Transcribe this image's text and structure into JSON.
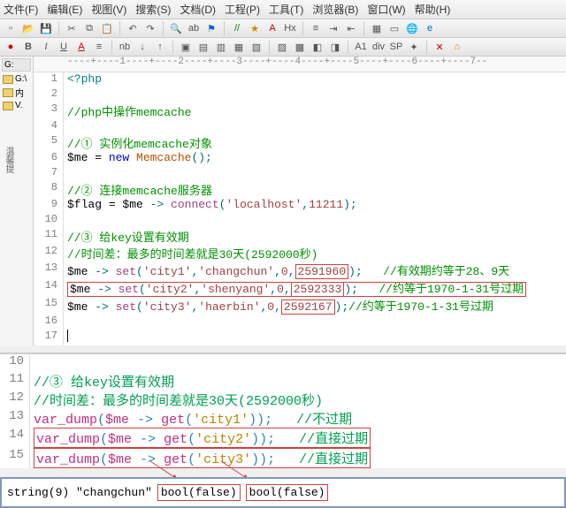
{
  "menu": {
    "file": "文件(F)",
    "edit": "编辑(E)",
    "view": "视图(V)",
    "search": "搜索(S)",
    "doc": "文档(D)",
    "project": "工程(P)",
    "tools": "工具(T)",
    "browser": "浏览器(B)",
    "window": "窗口(W)",
    "help": "帮助(H)"
  },
  "sidebar": {
    "label": "G:",
    "folder1": "G:\\",
    "folder2": "内",
    "folder3": "V.",
    "vertical": "温馨提"
  },
  "ruler": "----+----1----+----2----+----3----+----4----+----5----+----6----+----7--",
  "code1": {
    "l1": "<?php",
    "l3": "//php中操作memcache",
    "l5": "//① 实例化memcache对象",
    "l6_var": "$me",
    "l6_eq": " = ",
    "l6_new": "new",
    "l6_cls": " Memcache",
    "l6_paren": "();",
    "l8": "//② 连接memcache服务器",
    "l9_var": "$flag",
    "l9_eq": " = ",
    "l9_me": "$me",
    "l9_arr": " -> ",
    "l9_fn": "connect",
    "l9_paren": "(",
    "l9_s1": "'localhost'",
    "l9_c": ",",
    "l9_n": "11211",
    "l9_end": ");",
    "l11": "//③ 给key设置有效期",
    "l12": "//时间差：最多的时间差就是30天(2592000秒)",
    "l13_me": "$me",
    "l13_arr": " -> ",
    "l13_fn": "set",
    "l13_p": "(",
    "l13_s1": "'city1'",
    "l13_c1": ",",
    "l13_s2": "'changchun'",
    "l13_c2": ",",
    "l13_n1": "0",
    "l13_c3": ",",
    "l13_n2": "2591960",
    "l13_end": ");",
    "l13_comm": "   //有效期约等于28、9天",
    "l14_me": "$me",
    "l14_arr": " -> ",
    "l14_fn": "set",
    "l14_p": "(",
    "l14_s1": "'city2'",
    "l14_c1": ",",
    "l14_s2": "'shenyang'",
    "l14_c2": ",",
    "l14_n1": "0",
    "l14_c3": ",",
    "l14_n2": "2592333",
    "l14_end": ");",
    "l14_comm": "   //约等于1970-1-31号过期",
    "l15_me": "$me",
    "l15_arr": " -> ",
    "l15_fn": "set",
    "l15_p": "(",
    "l15_s1": "'city3'",
    "l15_c1": ",",
    "l15_s2": "'haerbin'",
    "l15_c2": ",",
    "l15_n1": "0",
    "l15_c3": ",",
    "l15_n2": "2592167",
    "l15_end": ");",
    "l15_comm": "//约等于1970-1-31号过期"
  },
  "code2": {
    "l11": "//③ 给key设置有效期",
    "l12": "//时间差：最多的时间差就是30天(2592000秒)",
    "l13_fn": "var_dump",
    "l13_p": "(",
    "l13_me": "$me",
    "l13_arr": " -> ",
    "l13_get": "get",
    "l13_p2": "(",
    "l13_s": "'city1'",
    "l13_end": "));",
    "l13_comm": "   //不过期",
    "l14_fn": "var_dump",
    "l14_p": "(",
    "l14_me": "$me",
    "l14_arr": " -> ",
    "l14_get": "get",
    "l14_p2": "(",
    "l14_s": "'city2'",
    "l14_end": "));",
    "l14_comm": "   //直接过期",
    "l15_fn": "var_dump",
    "l15_p": "(",
    "l15_me": "$me",
    "l15_arr": " -> ",
    "l15_get": "get",
    "l15_p2": "(",
    "l15_s": "'city3'",
    "l15_end": "));",
    "l15_comm": "   //直接过期"
  },
  "output": {
    "s": "string(9) \"changchun\"",
    "b1": "bool(false)",
    "b2": "bool(false)"
  },
  "lines1": [
    "1",
    "2",
    "3",
    "4",
    "5",
    "6",
    "7",
    "8",
    "9",
    "10",
    "11",
    "12",
    "13",
    "14",
    "15",
    "16",
    "17"
  ],
  "lines2": [
    "10",
    "11",
    "12",
    "13",
    "14",
    "15"
  ],
  "tb2": {
    "b": "B",
    "i": "I",
    "u": "U",
    "nb": "nb",
    "div": "div",
    "sp": "SP",
    "hx": "Hx",
    "a1": "A1"
  }
}
